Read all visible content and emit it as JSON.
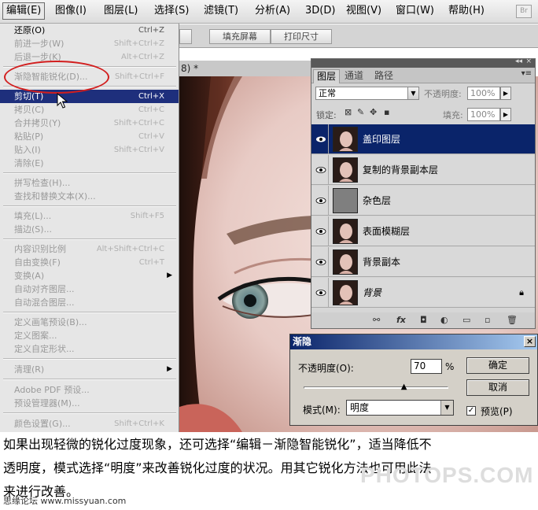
{
  "menubar": {
    "items": [
      "编辑(E)",
      "图像(I)",
      "图层(L)",
      "选择(S)",
      "滤镜(T)",
      "分析(A)",
      "3D(D)",
      "视图(V)",
      "窗口(W)",
      "帮助(H)"
    ],
    "bridge_icon": "Br"
  },
  "optbar": {
    "btn1": "",
    "btn2": "填充屏幕",
    "btn3": "打印尺寸"
  },
  "document": {
    "tab_title": "8) *"
  },
  "edit_menu": {
    "items": [
      {
        "label": "还原(O)",
        "shortcut": "Ctrl+Z"
      },
      {
        "label": "前进一步(W)",
        "shortcut": "Shift+Ctrl+Z"
      },
      {
        "label": "后退一步(K)",
        "shortcut": "Alt+Ctrl+Z"
      },
      {
        "label": "渐隐智能锐化(D)...",
        "shortcut": "Shift+Ctrl+F"
      },
      {
        "label": "剪切(T)",
        "shortcut": "Ctrl+X"
      },
      {
        "label": "拷贝(C)",
        "shortcut": "Ctrl+C"
      },
      {
        "label": "合并拷贝(Y)",
        "shortcut": "Shift+Ctrl+C"
      },
      {
        "label": "粘贴(P)",
        "shortcut": "Ctrl+V"
      },
      {
        "label": "贴入(I)",
        "shortcut": "Shift+Ctrl+V"
      },
      {
        "label": "清除(E)",
        "shortcut": ""
      },
      {
        "label": "拼写检查(H)...",
        "shortcut": ""
      },
      {
        "label": "查找和替换文本(X)...",
        "shortcut": ""
      },
      {
        "label": "填充(L)...",
        "shortcut": "Shift+F5"
      },
      {
        "label": "描边(S)...",
        "shortcut": ""
      },
      {
        "label": "内容识别比例",
        "shortcut": "Alt+Shift+Ctrl+C"
      },
      {
        "label": "自由变换(F)",
        "shortcut": "Ctrl+T"
      },
      {
        "label": "变换(A)",
        "shortcut": ""
      },
      {
        "label": "自动对齐图层...",
        "shortcut": ""
      },
      {
        "label": "自动混合图层...",
        "shortcut": ""
      },
      {
        "label": "定义画笔预设(B)...",
        "shortcut": ""
      },
      {
        "label": "定义图案...",
        "shortcut": ""
      },
      {
        "label": "定义自定形状...",
        "shortcut": ""
      },
      {
        "label": "清理(R)",
        "shortcut": ""
      },
      {
        "label": "Adobe PDF 预设...",
        "shortcut": ""
      },
      {
        "label": "预设管理器(M)...",
        "shortcut": ""
      },
      {
        "label": "颜色设置(G)...",
        "shortcut": "Shift+Ctrl+K"
      }
    ]
  },
  "layers_panel": {
    "tabs": [
      "图层",
      "通道",
      "路径"
    ],
    "blend_mode": "正常",
    "opacity_label": "不透明度:",
    "opacity_value": "100%",
    "lock_label": "锁定:",
    "fill_label": "填充:",
    "fill_value": "100%",
    "layers": [
      {
        "name": "盖印图层",
        "selected": true
      },
      {
        "name": "复制的背景副本层",
        "selected": false
      },
      {
        "name": "杂色层",
        "selected": false
      },
      {
        "name": "表面模糊层",
        "selected": false
      },
      {
        "name": "背景副本",
        "selected": false
      },
      {
        "name": "背景",
        "selected": false
      }
    ]
  },
  "fade_dialog": {
    "title": "渐隐",
    "opacity_label": "不透明度(O):",
    "opacity_value": "70",
    "percent": "%",
    "opacity_level": 0.7,
    "mode_label": "模式(M):",
    "mode_value": "明度",
    "ok": "确定",
    "cancel": "取消",
    "preview": "预览(P)"
  },
  "caption": {
    "line1": "如果出现轻微的锐化过度现象，还可选择“编辑－渐隐智能锐化”，适当降低不",
    "line2": "透明度，模式选择“明度”来改善锐化过度的状况。用其它锐化方法也可用此法",
    "line3": "来进行改善。",
    "watermark": "PHOTOPS.COM",
    "site": "思缘论坛 www.missyuan.com"
  },
  "colors": {
    "selection": "#1e2f7c",
    "layer_selected": "#0a246a",
    "callout": "#d21e1e"
  }
}
